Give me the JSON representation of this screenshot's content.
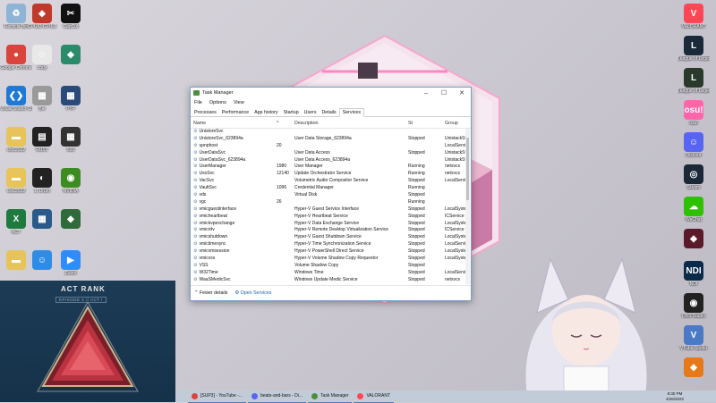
{
  "desktop": {
    "left_icons": [
      {
        "label": "Recycle Bin",
        "color": "#8fb4d6",
        "icon": "recycle-bin-icon",
        "glyph": "♻"
      },
      {
        "label": "Google Chrome",
        "color": "#d9453c",
        "icon": "chrome-icon",
        "glyph": "●"
      },
      {
        "label": "Visual Studio Code",
        "color": "#1e7ad6",
        "icon": "vscode-icon",
        "glyph": "❮❯"
      },
      {
        "label": "ckd.2022",
        "color": "#e6c45a",
        "icon": "folder-icon",
        "glyph": "▬"
      },
      {
        "label": "ckd.2022",
        "color": "#e6c45a",
        "icon": "folder-icon",
        "glyph": "▬"
      },
      {
        "label": "ACT",
        "color": "#1f7a3f",
        "icon": "excel-icon",
        "glyph": "X"
      },
      {
        "label": "",
        "color": "#e6c45a",
        "icon": "file-icon",
        "glyph": "▬"
      }
    ],
    "col2_icons": [
      {
        "label": "CPUID CPU-Z",
        "color": "#c0392b",
        "icon": "cpuz-icon",
        "glyph": "◆"
      },
      {
        "label": "cody",
        "color": "#e8e8e8",
        "icon": "cody-icon",
        "glyph": "☺"
      },
      {
        "label": "Ble",
        "color": "#9a9a9a",
        "icon": "app-icon",
        "glyph": "▦"
      },
      {
        "label": "RUST",
        "color": "#222222",
        "icon": "rust-icon",
        "glyph": "▤"
      },
      {
        "label": "1. Drum",
        "color": "#222222",
        "icon": "drum-icon",
        "glyph": "◐"
      },
      {
        "label": "",
        "color": "#2a5a8a",
        "icon": "app-icon",
        "glyph": "▦"
      },
      {
        "label": "",
        "color": "#2f8ce6",
        "icon": "discord-icon",
        "glyph": "☺"
      }
    ],
    "col3_icons": [
      {
        "label": "CapCut",
        "color": "#111111",
        "icon": "capcut-icon",
        "glyph": "✂"
      },
      {
        "label": "",
        "color": "#2a8a6a",
        "icon": "app-icon",
        "glyph": "◆"
      },
      {
        "label": "PYP",
        "color": "#2a4a7a",
        "icon": "app-icon",
        "glyph": "▦"
      },
      {
        "label": "500",
        "color": "#333333",
        "icon": "app-icon",
        "glyph": "▦"
      },
      {
        "label": "NVIDIA",
        "color": "#3d8c1f",
        "icon": "nvidia-icon",
        "glyph": "◉"
      },
      {
        "label": "",
        "color": "#2f6a3a",
        "icon": "app-icon",
        "glyph": "◆"
      },
      {
        "label": "Zoom",
        "color": "#2d8cff",
        "icon": "zoom-icon",
        "glyph": "▶"
      }
    ],
    "right_icons": [
      {
        "label": "VALORANT",
        "color": "#ff4655",
        "icon": "valorant-icon",
        "glyph": "V"
      },
      {
        "label": "League of Legends",
        "color": "#1a2a3a",
        "icon": "league-icon",
        "glyph": "L"
      },
      {
        "label": "League of Legends",
        "color": "#2a3a2a",
        "icon": "league-icon",
        "glyph": "L"
      },
      {
        "label": "osu!",
        "color": "#ff66aa",
        "icon": "osu-icon",
        "glyph": "osu!"
      },
      {
        "label": "Discord",
        "color": "#5865f2",
        "icon": "discord-icon",
        "glyph": "☺"
      },
      {
        "label": "Steam",
        "color": "#1b2838",
        "icon": "steam-icon",
        "glyph": "◎"
      },
      {
        "label": "WeChat",
        "color": "#2dc100",
        "icon": "wechat-icon",
        "glyph": "☁"
      },
      {
        "label": "",
        "color": "#5a1a2a",
        "icon": "app-icon",
        "glyph": "◆"
      },
      {
        "label": "NDI",
        "color": "#0a2a4a",
        "icon": "ndi-icon",
        "glyph": "NDI"
      },
      {
        "label": "OBS Studio",
        "color": "#222222",
        "icon": "obs-icon",
        "glyph": "◉"
      },
      {
        "label": "VTube Studio",
        "color": "#4a7ac6",
        "icon": "vtube-icon",
        "glyph": "V"
      },
      {
        "label": "",
        "color": "#e67a1a",
        "icon": "app-icon",
        "glyph": "◆"
      }
    ]
  },
  "task_manager": {
    "title": "Task Manager",
    "window_controls": [
      "–",
      "☐",
      "✕"
    ],
    "menu": [
      "File",
      "Options",
      "View"
    ],
    "tabs": [
      "Processes",
      "Performance",
      "App history",
      "Startup",
      "Users",
      "Details",
      "Services"
    ],
    "active_tab": "Services",
    "columns": {
      "name": "Name",
      "pid": "^",
      "desc": "Description",
      "status": "St",
      "group": "Group"
    },
    "rows": [
      {
        "name": "UnistoreSvc",
        "pid": "",
        "desc": "",
        "status": "",
        "group": ""
      },
      {
        "name": "UnistoreSvc_623894a",
        "pid": "",
        "desc": "User Data Storage_623894a",
        "status": "Stopped",
        "group": "UnistackSvcGr..."
      },
      {
        "name": "upnphost",
        "pid": "20",
        "desc": "",
        "status": "",
        "group": "LocalServiceA..."
      },
      {
        "name": "UserDataSvc",
        "pid": "",
        "desc": "User Data Access",
        "status": "Stopped",
        "group": "UnistackSvcGr..."
      },
      {
        "name": "UserDataSvc_623894a",
        "pid": "",
        "desc": "User Data Access_623894a",
        "status": "",
        "group": "UnistackSvcGr..."
      },
      {
        "name": "UserManager",
        "pid": "1980",
        "desc": "User Manager",
        "status": "Running",
        "group": "netsvcs"
      },
      {
        "name": "UsoSvc",
        "pid": "12140",
        "desc": "Update Orchestrator Service",
        "status": "Running",
        "group": "netsvcs"
      },
      {
        "name": "VacSvc",
        "pid": "",
        "desc": "Volumetric Audio Compositor Service",
        "status": "Stopped",
        "group": "LocalServiceN..."
      },
      {
        "name": "VaultSvc",
        "pid": "1096",
        "desc": "Credential Manager",
        "status": "Running",
        "group": ""
      },
      {
        "name": "vds",
        "pid": "",
        "desc": "Virtual Disk",
        "status": "Stopped",
        "group": ""
      },
      {
        "name": "vgc",
        "pid": "26",
        "desc": "",
        "status": "Running",
        "group": ""
      },
      {
        "name": "vmicguestinterface",
        "pid": "",
        "desc": "Hyper-V Guest Service Interface",
        "status": "Stopped",
        "group": "LocalSystemN..."
      },
      {
        "name": "vmicheartbeat",
        "pid": "",
        "desc": "Hyper-V Heartbeat Service",
        "status": "Stopped",
        "group": "ICService"
      },
      {
        "name": "vmickvpexchange",
        "pid": "",
        "desc": "Hyper-V Data Exchange Service",
        "status": "Stopped",
        "group": "LocalSystemN..."
      },
      {
        "name": "vmicrdv",
        "pid": "",
        "desc": "Hyper-V Remote Desktop Virtualization Service",
        "status": "Stopped",
        "group": "ICService"
      },
      {
        "name": "vmicshutdown",
        "pid": "",
        "desc": "Hyper-V Guest Shutdown Service",
        "status": "Stopped",
        "group": "LocalSystemN..."
      },
      {
        "name": "vmictimesync",
        "pid": "",
        "desc": "Hyper-V Time Synchronization Service",
        "status": "Stopped",
        "group": "LocalServiceN..."
      },
      {
        "name": "vmicvmsession",
        "pid": "",
        "desc": "Hyper-V PowerShell Direct Service",
        "status": "Stopped",
        "group": "LocalSystemN..."
      },
      {
        "name": "vmicvss",
        "pid": "",
        "desc": "Hyper-V Volume Shadow Copy Requestor",
        "status": "Stopped",
        "group": "LocalSystemN..."
      },
      {
        "name": "VSS",
        "pid": "",
        "desc": "Volume Shadow Copy",
        "status": "Stopped",
        "group": ""
      },
      {
        "name": "W32Time",
        "pid": "",
        "desc": "Windows Time",
        "status": "Stopped",
        "group": "LocalService"
      },
      {
        "name": "WaaSMedicSvc",
        "pid": "",
        "desc": "Windows Update Medic Service",
        "status": "Stopped",
        "group": "netsvcs"
      }
    ],
    "footer": {
      "fewer_details": "Fewer details",
      "open_services": "Open Services"
    }
  },
  "act_rank": {
    "title": "ACT RANK",
    "subtitle": "EPISODE 4 // ACT I"
  },
  "taskbar": {
    "items": [
      {
        "label": "[SUP3] - YouTube -...",
        "color": "#d9453c",
        "icon": "chrome-icon"
      },
      {
        "label": "beats-and-bars - Di...",
        "color": "#5865f2",
        "icon": "discord-icon"
      },
      {
        "label": "Task Manager",
        "color": "#4a8f3b",
        "icon": "task-manager-icon"
      },
      {
        "label": "VALORANT",
        "color": "#ff4655",
        "icon": "valorant-icon"
      }
    ],
    "time": "8:30 PM",
    "date": "4/26/2022"
  },
  "colors": {
    "accent": "#1a5fb4",
    "room_pink": "#f05aa8",
    "act_bg": "#1c3b55"
  }
}
